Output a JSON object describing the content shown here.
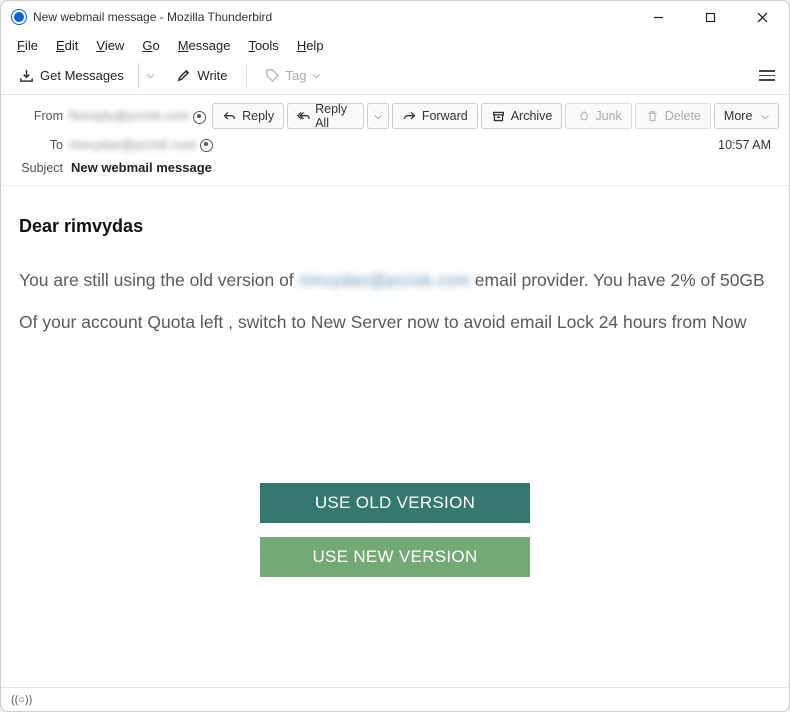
{
  "window": {
    "title": "New webmail message - Mozilla Thunderbird"
  },
  "menu": {
    "file": "File",
    "edit": "Edit",
    "view": "View",
    "go": "Go",
    "message": "Message",
    "tools": "Tools",
    "help": "Help"
  },
  "toolbar": {
    "get_messages": "Get Messages",
    "write": "Write",
    "tag": "Tag"
  },
  "actions": {
    "reply": "Reply",
    "reply_all": "Reply All",
    "forward": "Forward",
    "archive": "Archive",
    "junk": "Junk",
    "delete": "Delete",
    "more": "More"
  },
  "headers": {
    "from_label": "From",
    "from_value": "Noreply@pcrisk.com",
    "to_label": "To",
    "to_value": "rimvydas@pcrisk.com",
    "subject_label": "Subject",
    "subject_value": "New webmail message",
    "time": "10:57 AM"
  },
  "email_body": {
    "greeting": "Dear rimvydas",
    "line1_a": "You are still using the old version of ",
    "line1_blur": "rimvydas@pcrisk.com",
    "line1_b": " email provider. You have 2% of 50GB Of your account  Quota left , switch to New Server now to avoid email Lock 24 hours from Now",
    "btn_old": "USE OLD VERSION",
    "btn_new": "USE NEW VERSION"
  },
  "status": {
    "indicator": "((○))"
  }
}
